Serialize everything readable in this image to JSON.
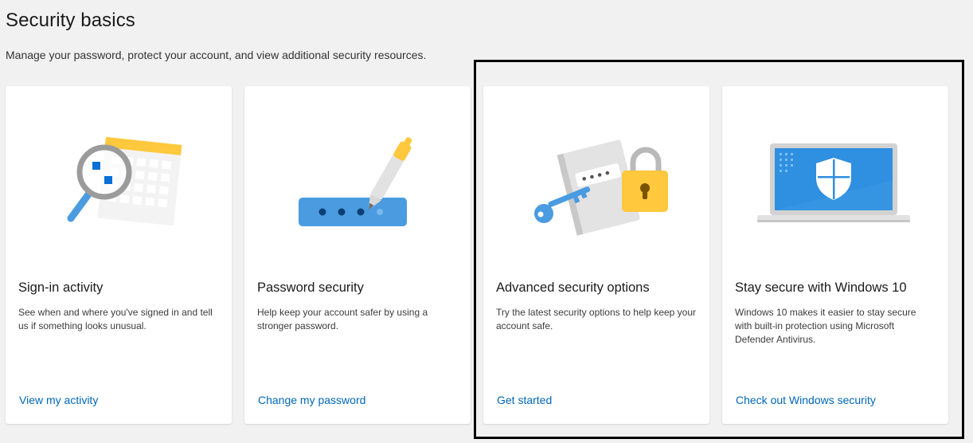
{
  "header": {
    "title": "Security basics",
    "subtitle": "Manage your password, protect your account, and view additional security resources."
  },
  "cards": [
    {
      "title": "Sign-in activity",
      "description": "See when and where you've signed in and tell us if something looks unusual.",
      "link": "View my activity",
      "icon": "magnifier-calendar-icon"
    },
    {
      "title": "Password security",
      "description": "Help keep your account safer by using a stronger password.",
      "link": "Change my password",
      "icon": "pen-password-field-icon"
    },
    {
      "title": "Advanced security options",
      "description": "Try the latest security options to help keep your account safe.",
      "link": "Get started",
      "icon": "key-padlock-icon"
    },
    {
      "title": "Stay secure with Windows 10",
      "description": "Windows 10 makes it easier to stay secure with built-in protection using Microsoft Defender Antivirus.",
      "link": "Check out Windows security",
      "icon": "laptop-shield-icon"
    }
  ],
  "colors": {
    "link": "#0067b8",
    "accent_yellow": "#ffc83d",
    "accent_blue": "#4a9be0"
  }
}
